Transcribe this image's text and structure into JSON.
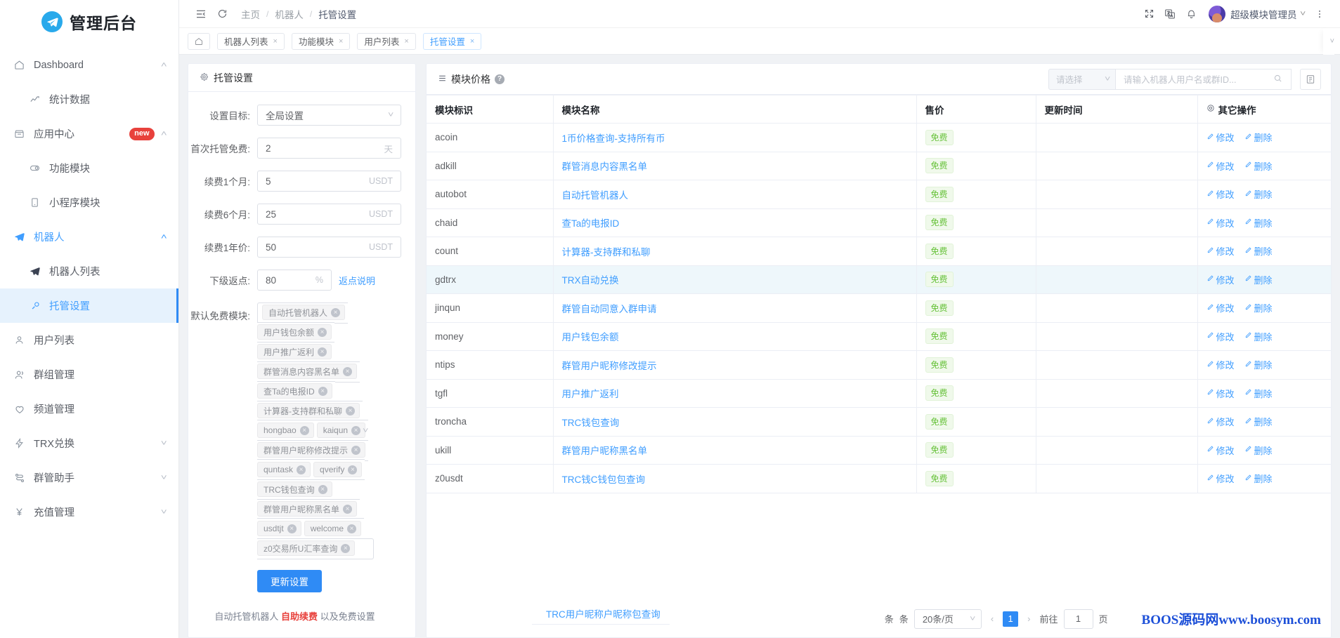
{
  "brand": {
    "title": "管理后台",
    "logo_icon": "telegram-plane-icon"
  },
  "sidebar": {
    "items": [
      {
        "label": "Dashboard",
        "icon": "home-icon",
        "arrow": "˄",
        "level": "top"
      },
      {
        "label": "统计数据",
        "icon": "trend-up-icon",
        "level": "sub"
      },
      {
        "label": "应用中心",
        "icon": "store-icon",
        "badge": "new",
        "arrow": "˄",
        "level": "top"
      },
      {
        "label": "功能模块",
        "icon": "module-icon",
        "level": "sub"
      },
      {
        "label": "小程序模块",
        "icon": "mini-app-icon",
        "level": "sub"
      },
      {
        "label": "机器人",
        "icon": "telegram-plane-icon",
        "arrow": "˄",
        "level": "top",
        "state": "active-parent"
      },
      {
        "label": "机器人列表",
        "icon": "telegram-plane-icon",
        "level": "sub"
      },
      {
        "label": "托管设置",
        "icon": "gear-link-icon",
        "level": "sub",
        "state": "selected"
      },
      {
        "label": "用户列表",
        "icon": "user-icon",
        "level": "top"
      },
      {
        "label": "群组管理",
        "icon": "users-icon",
        "level": "top"
      },
      {
        "label": "频道管理",
        "icon": "heart-icon",
        "level": "top"
      },
      {
        "label": "TRX兑换",
        "icon": "bolt-icon",
        "arrow": "˅",
        "level": "top"
      },
      {
        "label": "群管助手",
        "icon": "flow-icon",
        "arrow": "˅",
        "level": "top"
      },
      {
        "label": "充值管理",
        "icon": "yen-icon",
        "arrow": "˅",
        "level": "top"
      }
    ]
  },
  "topbar": {
    "collapse_icon": "menu-collapse-icon",
    "refresh_icon": "refresh-icon",
    "breadcrumbs": [
      "主页",
      "机器人",
      "托管设置"
    ],
    "separator": "/",
    "fullscreen_icon": "fullscreen-icon",
    "translate_icon": "translate-icon",
    "bell_icon": "bell-icon",
    "user_name": "超级模块管理员",
    "user_caret": "˅",
    "more_icon": "more-vertical-icon"
  },
  "tabs": {
    "home_icon": "home-icon",
    "items": [
      {
        "label": "机器人列表",
        "close": "×",
        "active": false
      },
      {
        "label": "功能模块",
        "close": "×",
        "active": false
      },
      {
        "label": "用户列表",
        "close": "×",
        "active": false
      },
      {
        "label": "托管设置",
        "close": "×",
        "active": true
      }
    ],
    "right_caret": "˅"
  },
  "settings_panel": {
    "title": "托管设置",
    "title_icon": "gear-icon",
    "fields": {
      "target_label": "设置目标:",
      "target_value": "全局设置",
      "first_free_label": "首次托管免费:",
      "first_free_value": "2",
      "first_free_unit": "天",
      "month1_label": "续费1个月:",
      "month1_value": "5",
      "month1_unit": "USDT",
      "month6_label": "续费6个月:",
      "month6_value": "25",
      "month6_unit": "USDT",
      "year1_label": "续费1年价:",
      "year1_value": "50",
      "year1_unit": "USDT",
      "rebate_label": "下级返点:",
      "rebate_value": "80",
      "rebate_unit": "%",
      "rebate_link": "返点说明",
      "modules_label": "默认免费模块:"
    },
    "free_modules": [
      "自动托管机器人",
      "用户钱包余额",
      "用户推广返利",
      "群管消息内容黑名单",
      "查Ta的电报ID",
      "计算器-支持群和私聊",
      "hongbao",
      "kaiqun",
      "群管用户昵称修改提示",
      "quntask",
      "qverify",
      "TRC钱包查询",
      "群管用户昵称黑名单",
      "usdtjt",
      "welcome",
      "z0交易所U汇率查询"
    ],
    "tag_close": "×",
    "submit_label": "更新设置",
    "footer_note_pre": "自动托管机器人 ",
    "footer_note_hot": "自助续费",
    "footer_note_post": " 以及免费设置"
  },
  "price_panel": {
    "title": "模块价格",
    "title_icon": "list-icon",
    "help_icon": "question-icon",
    "select_placeholder": "请选择",
    "select_caret": "˅",
    "search_placeholder": "请输入机器人用户名或群ID...",
    "search_icon": "search-icon",
    "export_icon": "export-icon",
    "columns": [
      "模块标识",
      "模块名称",
      "售价",
      "更新时间",
      "其它操作"
    ],
    "columns_icon": "gear-icon",
    "rows": [
      {
        "id": "acoin",
        "name": "1币价格查询-支持所有币",
        "price": "免费",
        "updated": ""
      },
      {
        "id": "adkill",
        "name": "群管消息内容黑名单",
        "price": "免费",
        "updated": ""
      },
      {
        "id": "autobot",
        "name": "自动托管机器人",
        "price": "免费",
        "updated": ""
      },
      {
        "id": "chaid",
        "name": "查Ta的电报ID",
        "price": "免费",
        "updated": ""
      },
      {
        "id": "count",
        "name": "计算器-支持群和私聊",
        "price": "免费",
        "updated": ""
      },
      {
        "id": "gdtrx",
        "name": "TRX自动兑换",
        "price": "免费",
        "updated": ""
      },
      {
        "id": "jinqun",
        "name": "群管自动同意入群申请",
        "price": "免费",
        "updated": ""
      },
      {
        "id": "money",
        "name": "用户钱包余额",
        "price": "免费",
        "updated": ""
      },
      {
        "id": "ntips",
        "name": "群管用户昵称修改提示",
        "price": "免费",
        "updated": ""
      },
      {
        "id": "tgfl",
        "name": "用户推广返利",
        "price": "免费",
        "updated": ""
      },
      {
        "id": "troncha",
        "name": "TRC钱包查询",
        "price": "免费",
        "updated": ""
      },
      {
        "id": "ukill",
        "name": "群管用户昵称黑名单",
        "price": "免费",
        "updated": ""
      },
      {
        "id": "z0usdt",
        "name": "TRC钱C钱包包查询",
        "price": "免费",
        "updated": ""
      }
    ],
    "edit_label": "修改",
    "delete_label": "删除",
    "edit_icon": "pencil-icon",
    "delete_icon": "pencil-icon",
    "overflow_row_name": "TRC用户昵称户昵称包查询",
    "pagination": {
      "unit_a": "条",
      "unit_b": "条",
      "page_size": "20条/页",
      "page_size_caret": "˅",
      "prev": "‹",
      "current": "1",
      "next": "›",
      "goto_label": "前往",
      "goto_value": "1",
      "goto_unit": "页"
    },
    "watermark": "BOOS源码网www.boosym.com"
  }
}
